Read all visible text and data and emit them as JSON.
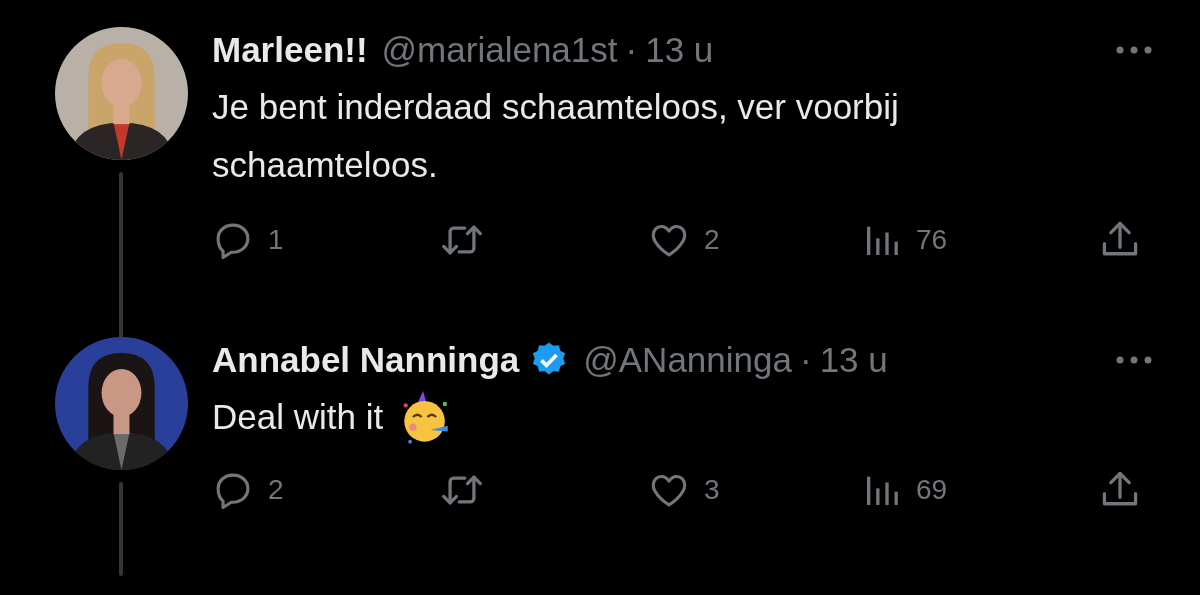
{
  "tweets": [
    {
      "name": "Marleen!!",
      "verified": false,
      "handle": "@marialena1st",
      "separator": "·",
      "time": "13 u",
      "text": "Je bent inderdaad schaamteloos, ver voorbij schaamteloos.",
      "party_emoji": false,
      "actions": {
        "replies": "1",
        "likes": "2",
        "views": "76"
      }
    },
    {
      "name": "Annabel Nanninga",
      "verified": true,
      "handle": "@ANanninga",
      "separator": "·",
      "time": "13 u",
      "text": "Deal with it",
      "party_emoji": true,
      "actions": {
        "replies": "2",
        "likes": "3",
        "views": "69"
      }
    }
  ]
}
